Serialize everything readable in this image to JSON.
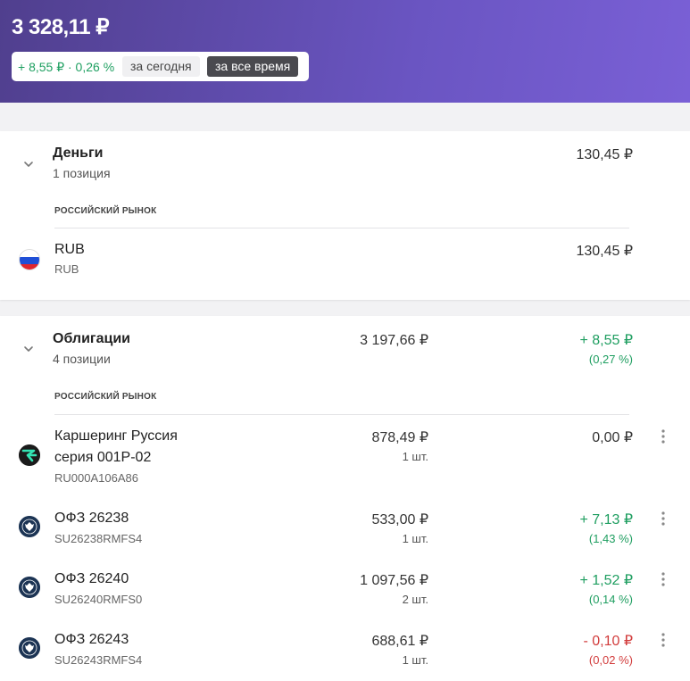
{
  "header": {
    "total": "3 328,11 ₽",
    "change": "+ 8,55 ₽ · 0,26 %",
    "period_today": "за сегодня",
    "period_all": "за все время",
    "gradient_start": "#503f8e",
    "gradient_end": "#7a60d6"
  },
  "colors": {
    "positive": "#1e9e60",
    "negative": "#d23c3c"
  },
  "money": {
    "title": "Деньги",
    "subtitle": "1 позиция",
    "total": "130,45 ₽",
    "market": "РОССИЙСКИЙ РЫНОК",
    "items": [
      {
        "name": "RUB",
        "code": "RUB",
        "value": "130,45 ₽",
        "icon": "russia-flag-icon"
      }
    ]
  },
  "bonds": {
    "title": "Облигации",
    "subtitle": "4 позиции",
    "total": "3 197,66 ₽",
    "change": "+ 8,55 ₽",
    "change_pct": "(0,27 %)",
    "market": "РОССИЙСКИЙ РЫНОК",
    "items": [
      {
        "name_line1": "Каршеринг Руссия",
        "name_line2": "серия 001Р-02",
        "code": "RU000A106A86",
        "value": "878,49 ₽",
        "qty": "1 шт.",
        "change": "0,00 ₽",
        "change_pct": "",
        "icon": "carsharing-logo-icon"
      },
      {
        "name_line1": "ОФЗ 26238",
        "code": "SU26238RMFS4",
        "value": "533,00 ₽",
        "qty": "1 шт.",
        "change": "+ 7,13 ₽",
        "change_pct": "(1,43 %)",
        "icon": "minfin-emblem-icon"
      },
      {
        "name_line1": "ОФЗ 26240",
        "code": "SU26240RMFS0",
        "value": "1 097,56 ₽",
        "qty": "2 шт.",
        "change": "+ 1,52 ₽",
        "change_pct": "(0,14 %)",
        "icon": "minfin-emblem-icon"
      },
      {
        "name_line1": "ОФЗ 26243",
        "code": "SU26243RMFS4",
        "value": "688,61 ₽",
        "qty": "1 шт.",
        "change": "- 0,10 ₽",
        "change_pct": "(0,02 %)",
        "icon": "minfin-emblem-icon"
      }
    ]
  }
}
